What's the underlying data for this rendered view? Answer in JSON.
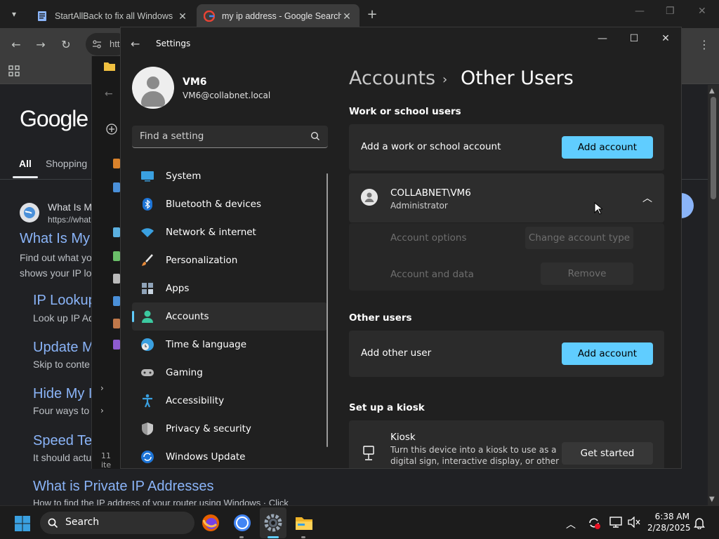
{
  "browser": {
    "tabs": [
      {
        "title": "StartAllBack to fix all Windows"
      },
      {
        "title": "my ip address - Google Search"
      }
    ],
    "omnibox_text": "htt",
    "logo": "Google",
    "search_tabs": [
      "All",
      "Shopping"
    ],
    "results": [
      {
        "site": "What Is M",
        "url": "https://what",
        "heading": "What Is My",
        "snippet1": "Find out what yo",
        "snippet2": "shows your IP lo"
      },
      {
        "heading": "IP Lookup",
        "snippet": "Look up IP Ad"
      },
      {
        "heading": "Update M",
        "snippet": "Skip to conte"
      },
      {
        "heading": "Hide My I",
        "snippet": "Four ways to"
      },
      {
        "heading": "Speed Te",
        "snippet": "It should actu"
      },
      {
        "heading": "What is Private IP Addresses",
        "snippet": "How to find the IP address of your router using Windows · Click"
      }
    ]
  },
  "explorer": {
    "status": "11 ite"
  },
  "settings": {
    "window_title": "Settings",
    "user": {
      "name": "VM6",
      "email": "VM6@collabnet.local"
    },
    "search_placeholder": "Find a setting",
    "nav": [
      {
        "label": "System",
        "icon": "monitor-icon"
      },
      {
        "label": "Bluetooth & devices",
        "icon": "bluetooth-icon"
      },
      {
        "label": "Network & internet",
        "icon": "wifi-icon"
      },
      {
        "label": "Personalization",
        "icon": "brush-icon"
      },
      {
        "label": "Apps",
        "icon": "apps-icon"
      },
      {
        "label": "Accounts",
        "icon": "person-icon",
        "selected": true
      },
      {
        "label": "Time & language",
        "icon": "globe-clock-icon"
      },
      {
        "label": "Gaming",
        "icon": "controller-icon"
      },
      {
        "label": "Accessibility",
        "icon": "accessibility-icon"
      },
      {
        "label": "Privacy & security",
        "icon": "shield-icon"
      },
      {
        "label": "Windows Update",
        "icon": "update-icon"
      }
    ],
    "breadcrumb": {
      "parent": "Accounts",
      "sep": "›",
      "current": "Other Users"
    },
    "work_section": {
      "heading": "Work or school users",
      "add_label": "Add a work or school account",
      "add_button": "Add account",
      "account": {
        "name": "COLLABNET\\VM6",
        "role": "Administrator"
      },
      "options_label": "Account options",
      "options_button": "Change account type",
      "data_label": "Account and data",
      "data_button": "Remove"
    },
    "other_section": {
      "heading": "Other users",
      "add_label": "Add other user",
      "add_button": "Add account"
    },
    "kiosk_section": {
      "heading": "Set up a kiosk",
      "title": "Kiosk",
      "desc1": "Turn this device into a kiosk to use as a",
      "desc2": "digital sign, interactive display, or other",
      "button": "Get started"
    },
    "accent_color": "#60cdff"
  },
  "taskbar": {
    "search_label": "Search",
    "time": "6:38 AM",
    "date": "2/28/2025"
  }
}
